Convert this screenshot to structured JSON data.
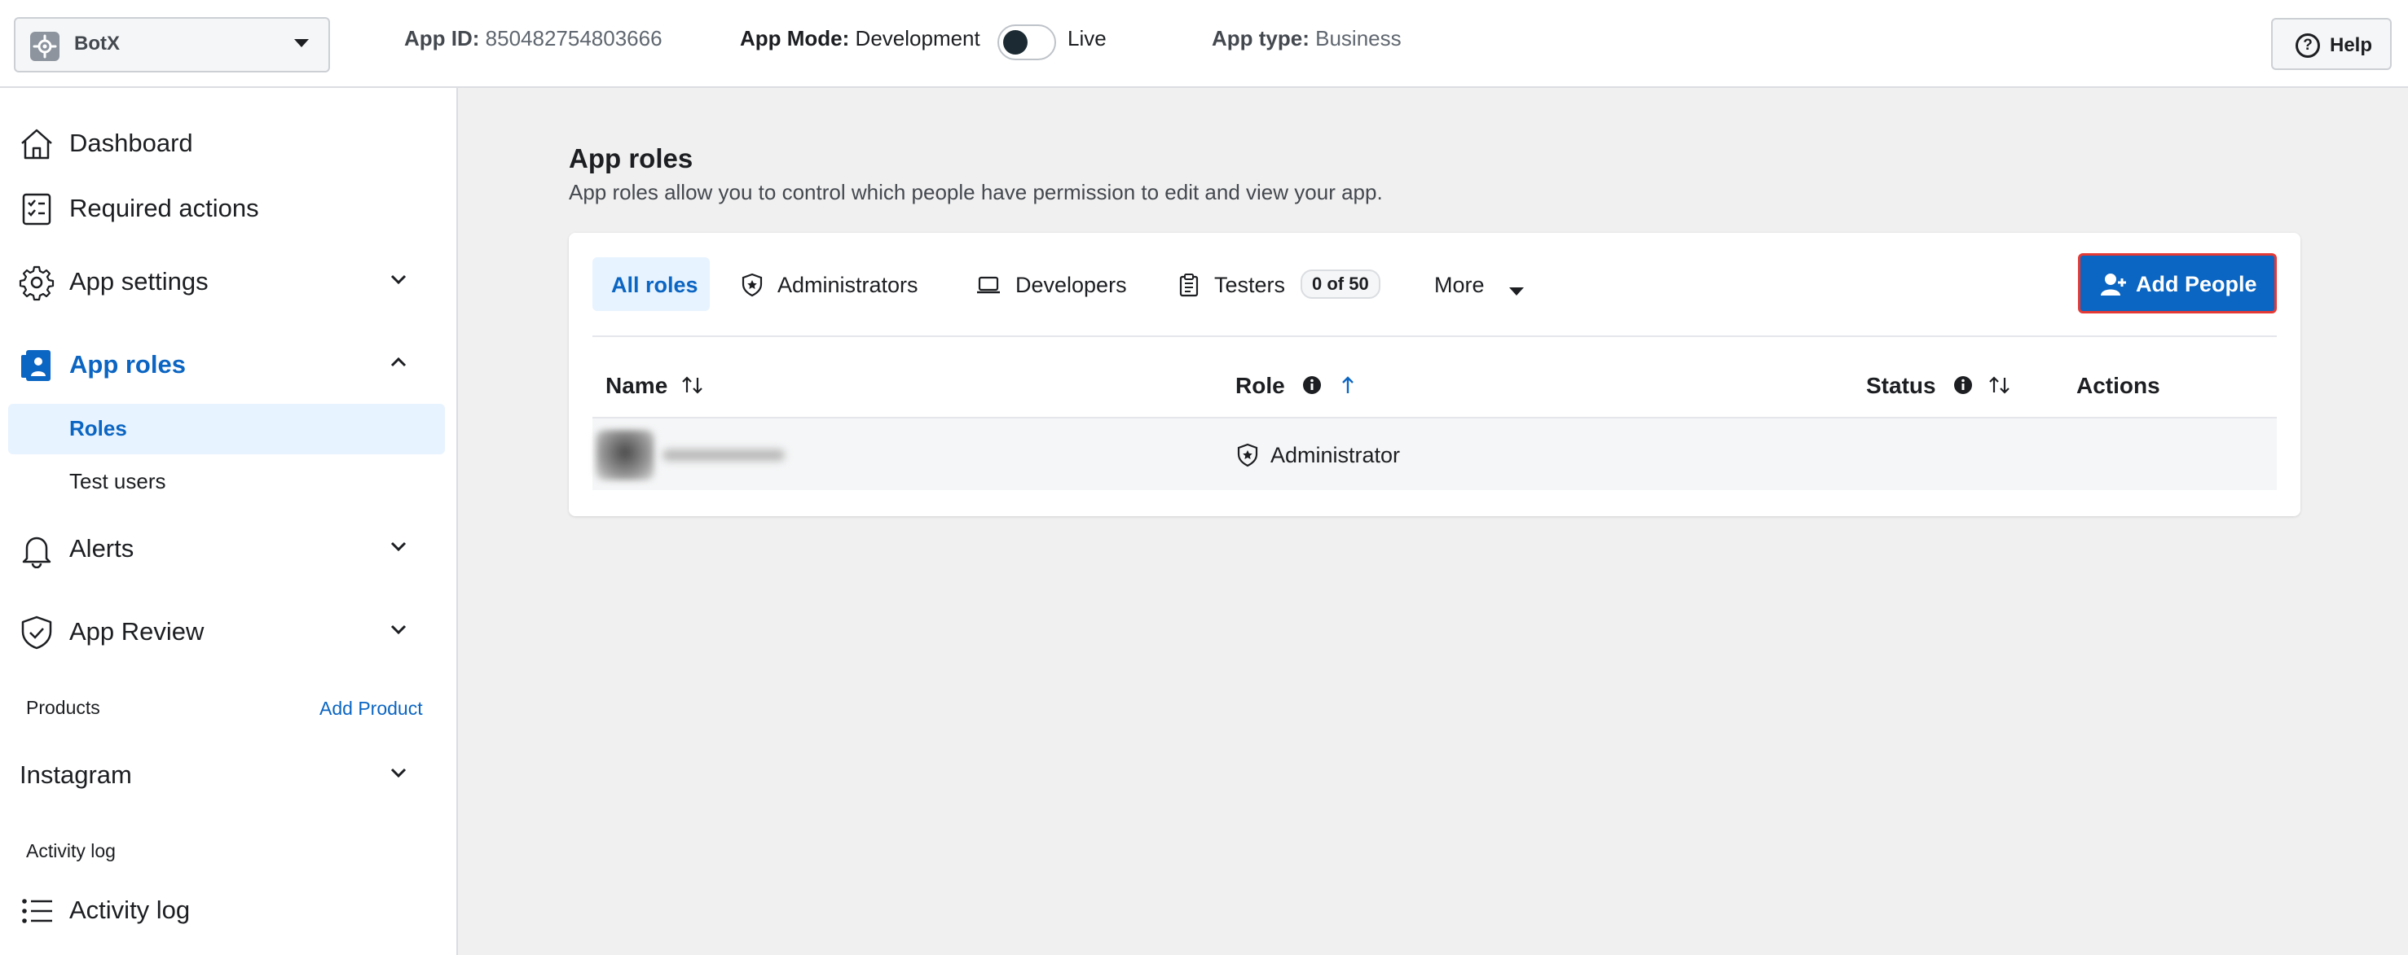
{
  "header": {
    "app_name": "BotX",
    "app_id_label": "App ID:",
    "app_id_value": "850482754803666",
    "app_mode_label": "App Mode:",
    "app_mode_value": "Development",
    "live_label": "Live",
    "app_type_label": "App type:",
    "app_type_value": "Business",
    "help_label": "Help"
  },
  "sidebar": {
    "dashboard": "Dashboard",
    "required_actions": "Required actions",
    "app_settings": "App settings",
    "app_roles": "App roles",
    "roles": "Roles",
    "test_users": "Test users",
    "alerts": "Alerts",
    "app_review": "App Review",
    "products": "Products",
    "add_product": "Add Product",
    "instagram": "Instagram",
    "activity_log_section": "Activity log",
    "activity_log": "Activity log"
  },
  "main": {
    "title": "App roles",
    "subtitle": "App roles allow you to control which people have permission to edit and view your app.",
    "tabs": {
      "all_roles": "All roles",
      "administrators": "Administrators",
      "developers": "Developers",
      "testers": "Testers",
      "testers_badge": "0 of 50",
      "more": "More"
    },
    "add_people": "Add People",
    "columns": {
      "name": "Name",
      "role": "Role",
      "status": "Status",
      "actions": "Actions"
    },
    "rows": [
      {
        "role": "Administrator"
      }
    ]
  },
  "colors": {
    "accent": "#0b65c2",
    "accent_light": "#e7f3ff",
    "highlight_border": "#e53935"
  }
}
